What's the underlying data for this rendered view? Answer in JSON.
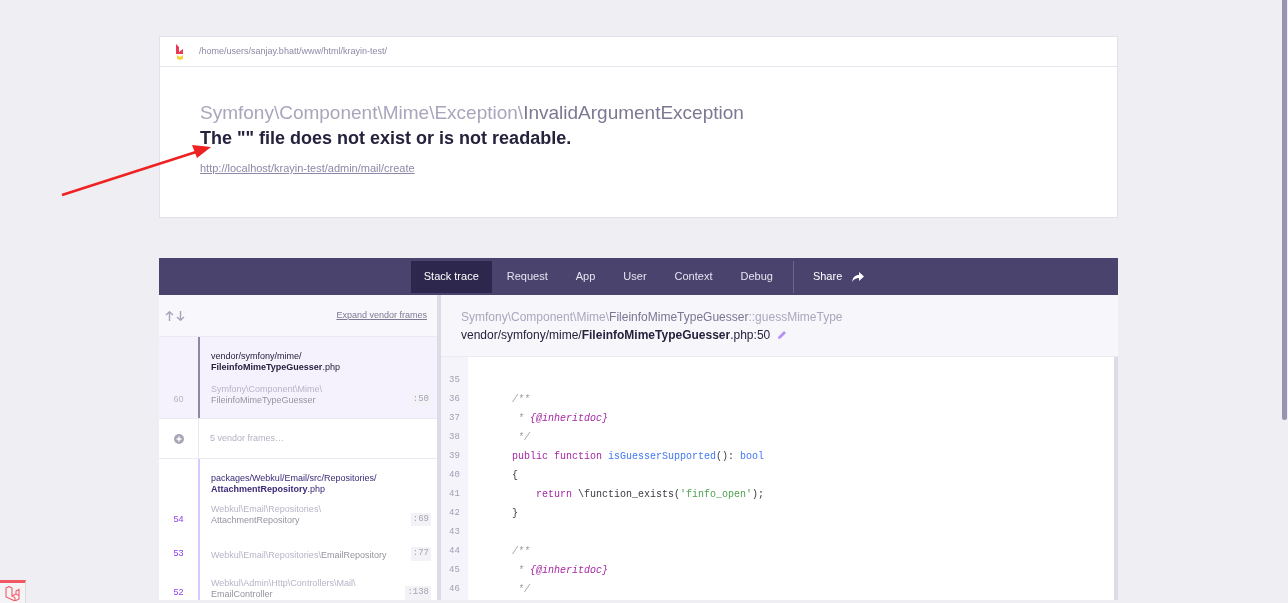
{
  "header": {
    "path": "/home/users/sanjay.bhatt/www/html/krayin-test/",
    "exception_namespace": "Symfony\\Component\\Mime\\Exception\\",
    "exception_class": "InvalidArgumentException",
    "message": "The \"\" file does not exist or is not readable.",
    "url": "http://localhost/krayin-test/admin/mail/create"
  },
  "tabs": [
    {
      "label": "Stack trace",
      "selected": true
    },
    {
      "label": "Request",
      "selected": false
    },
    {
      "label": "App",
      "selected": false
    },
    {
      "label": "User",
      "selected": false
    },
    {
      "label": "Context",
      "selected": false
    },
    {
      "label": "Debug",
      "selected": false
    }
  ],
  "share": {
    "label": "Share"
  },
  "frames_header": {
    "expand_link": "Expand vendor frames"
  },
  "frames": [
    {
      "kind": "frame",
      "number": "60",
      "selected": true,
      "app": false,
      "file_dir": "vendor/symfony/mime/",
      "file_name": "FileinfoMimeTypeGuesser",
      "file_ext": ".php",
      "class_ns": "Symfony\\Component\\Mime\\",
      "class_name": "FileinfoMimeTypeGuesser",
      "line": ":50"
    },
    {
      "kind": "collapsed",
      "label": "5 vendor frames…"
    },
    {
      "kind": "frame",
      "number": "54",
      "selected": false,
      "app": true,
      "file_dir": "packages/Webkul/Email/src/Repositories/",
      "file_name": "AttachmentRepository",
      "file_ext": ".php",
      "class_ns": "Webkul\\Email\\Repositories\\",
      "class_name": "AttachmentRepository",
      "line": ":69"
    },
    {
      "kind": "frame",
      "number": "53",
      "selected": false,
      "app": true,
      "class_ns": "Webkul\\Email\\Repositories\\",
      "class_name": "EmailRepository",
      "line": ":77",
      "inline": true
    },
    {
      "kind": "frame",
      "number": "52",
      "selected": false,
      "app": true,
      "class_ns": "Webkul\\Admin\\Http\\Controllers\\Mail\\",
      "class_name": "EmailController",
      "line": ":138"
    }
  ],
  "source": {
    "class_ns": "Symfony\\Component\\Mime\\",
    "class_name": "FileinfoMimeTypeGuesser",
    "method": "::guessMimeType",
    "file_dir": "vendor/symfony/mime/",
    "file_name": "FileinfoMimeTypeGuesser",
    "file_suffix": ".php:50"
  },
  "code": [
    {
      "number": "35"
    },
    {
      "number": "36",
      "tokens": [
        {
          "kind": "comment",
          "text": "    /**"
        }
      ]
    },
    {
      "number": "37",
      "tokens": [
        {
          "kind": "comment",
          "text": "     * "
        },
        {
          "kind": "doctag",
          "text": "{@inheritdoc}"
        }
      ]
    },
    {
      "number": "38",
      "tokens": [
        {
          "kind": "comment",
          "text": "     */"
        }
      ]
    },
    {
      "number": "39",
      "tokens": [
        {
          "kind": "keyword",
          "text": "    public function "
        },
        {
          "kind": "function",
          "text": "isGuesserSupported"
        },
        {
          "kind": "plain",
          "text": "(): "
        },
        {
          "kind": "type",
          "text": "bool"
        }
      ]
    },
    {
      "number": "40",
      "tokens": [
        {
          "kind": "plain",
          "text": "    {"
        }
      ]
    },
    {
      "number": "41",
      "tokens": [
        {
          "kind": "keyword",
          "text": "        return "
        },
        {
          "kind": "plain",
          "text": "\\function_exists("
        },
        {
          "kind": "string",
          "text": "'finfo_open'"
        },
        {
          "kind": "plain",
          "text": ");"
        }
      ]
    },
    {
      "number": "42",
      "tokens": [
        {
          "kind": "plain",
          "text": "    }"
        }
      ]
    },
    {
      "number": "43"
    },
    {
      "number": "44",
      "tokens": [
        {
          "kind": "comment",
          "text": "    /**"
        }
      ]
    },
    {
      "number": "45",
      "tokens": [
        {
          "kind": "comment",
          "text": "     * "
        },
        {
          "kind": "doctag",
          "text": "{@inheritdoc}"
        }
      ]
    },
    {
      "number": "46",
      "tokens": [
        {
          "kind": "comment",
          "text": "     */"
        }
      ]
    }
  ]
}
